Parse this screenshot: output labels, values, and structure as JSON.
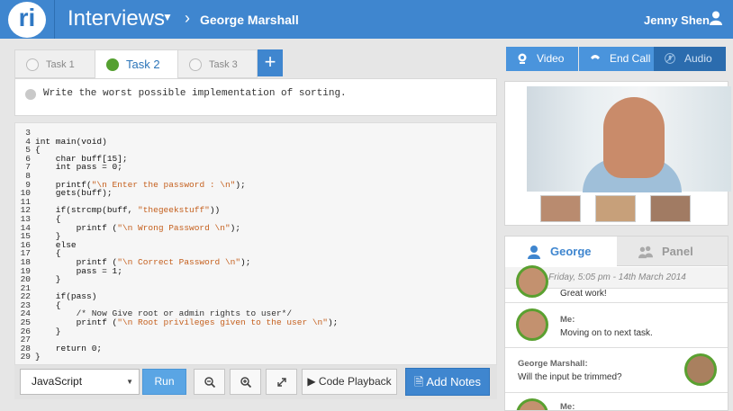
{
  "header": {
    "logo_text": "ri",
    "app_title": "Interviews",
    "breadcrumb": "George Marshall",
    "user_name": "Jenny Shen"
  },
  "tasks": {
    "tabs": [
      {
        "label": "Task 1",
        "active": false
      },
      {
        "label": "Task 2",
        "active": true
      },
      {
        "label": "Task 3",
        "active": false
      }
    ],
    "add_label": "+",
    "description": "Write the worst possible implementation of sorting."
  },
  "code_lines": [
    {
      "n": "3",
      "segs": [
        {
          "t": "",
          "c": "cl"
        }
      ]
    },
    {
      "n": "4",
      "segs": [
        {
          "t": "int main(void)",
          "c": "cl"
        }
      ]
    },
    {
      "n": "5",
      "segs": [
        {
          "t": "{",
          "c": "cl"
        }
      ]
    },
    {
      "n": "6",
      "segs": [
        {
          "t": "    char buff[15];",
          "c": "cl"
        }
      ]
    },
    {
      "n": "7",
      "segs": [
        {
          "t": "    int pass = 0;",
          "c": "cl"
        }
      ]
    },
    {
      "n": "8",
      "segs": [
        {
          "t": "",
          "c": "cl"
        }
      ]
    },
    {
      "n": "9",
      "segs": [
        {
          "t": "    printf(",
          "c": "cl"
        },
        {
          "t": "\"\\n Enter the password : \\n\"",
          "c": "str"
        },
        {
          "t": ");",
          "c": "cl"
        }
      ]
    },
    {
      "n": "10",
      "segs": [
        {
          "t": "    gets(buff);",
          "c": "cl"
        }
      ]
    },
    {
      "n": "11",
      "segs": [
        {
          "t": "",
          "c": "cl"
        }
      ]
    },
    {
      "n": "12",
      "segs": [
        {
          "t": "    if(strcmp(buff, ",
          "c": "cl"
        },
        {
          "t": "\"thegeekstuff\"",
          "c": "str"
        },
        {
          "t": "))",
          "c": "cl"
        }
      ]
    },
    {
      "n": "13",
      "segs": [
        {
          "t": "    {",
          "c": "cl"
        }
      ]
    },
    {
      "n": "14",
      "segs": [
        {
          "t": "        printf (",
          "c": "cl"
        },
        {
          "t": "\"\\n Wrong Password \\n\"",
          "c": "str"
        },
        {
          "t": ");",
          "c": "cl"
        }
      ]
    },
    {
      "n": "15",
      "segs": [
        {
          "t": "    }",
          "c": "cl"
        }
      ]
    },
    {
      "n": "16",
      "segs": [
        {
          "t": "    else",
          "c": "cl"
        }
      ]
    },
    {
      "n": "17",
      "segs": [
        {
          "t": "    {",
          "c": "cl"
        }
      ]
    },
    {
      "n": "18",
      "segs": [
        {
          "t": "        printf (",
          "c": "cl"
        },
        {
          "t": "\"\\n Correct Password \\n\"",
          "c": "str"
        },
        {
          "t": ");",
          "c": "cl"
        }
      ]
    },
    {
      "n": "19",
      "segs": [
        {
          "t": "        pass = 1;",
          "c": "cl"
        }
      ]
    },
    {
      "n": "20",
      "segs": [
        {
          "t": "    }",
          "c": "cl"
        }
      ]
    },
    {
      "n": "21",
      "segs": [
        {
          "t": "",
          "c": "cl"
        }
      ]
    },
    {
      "n": "22",
      "segs": [
        {
          "t": "    if(pass)",
          "c": "cl"
        }
      ]
    },
    {
      "n": "23",
      "segs": [
        {
          "t": "    {",
          "c": "cl"
        }
      ]
    },
    {
      "n": "24",
      "segs": [
        {
          "t": "        /* Now Give root or admin rights to user*/",
          "c": "cm"
        }
      ]
    },
    {
      "n": "25",
      "segs": [
        {
          "t": "        printf (",
          "c": "cl"
        },
        {
          "t": "\"\\n Root privileges given to the user \\n\"",
          "c": "str"
        },
        {
          "t": ");",
          "c": "cl"
        }
      ]
    },
    {
      "n": "26",
      "segs": [
        {
          "t": "    }",
          "c": "cl"
        }
      ]
    },
    {
      "n": "27",
      "segs": [
        {
          "t": "",
          "c": "cl"
        }
      ]
    },
    {
      "n": "28",
      "segs": [
        {
          "t": "    return 0;",
          "c": "cl"
        }
      ]
    },
    {
      "n": "29",
      "segs": [
        {
          "t": "}",
          "c": "cl"
        }
      ]
    }
  ],
  "toolbar": {
    "language": "JavaScript",
    "run_label": "Run",
    "playback_label": "Code Playback",
    "add_notes_label": "Add Notes"
  },
  "call": {
    "video_label": "Video",
    "end_call_label": "End Call",
    "audio_label": "Audio"
  },
  "chat": {
    "tab_george": "George",
    "tab_panel": "Panel",
    "date": "Friday, 5:05 pm - 14th March 2014",
    "prev_text": "Great work!",
    "messages": [
      {
        "name": "Me:",
        "text": "Moving on to next task."
      },
      {
        "name": "George Marshall:",
        "text": "Will the input be trimmed?"
      },
      {
        "name": "Me:",
        "text": ""
      }
    ]
  },
  "colors": {
    "brand": "#3f86cf",
    "active_green": "#55a030",
    "string": "#c5601e"
  }
}
